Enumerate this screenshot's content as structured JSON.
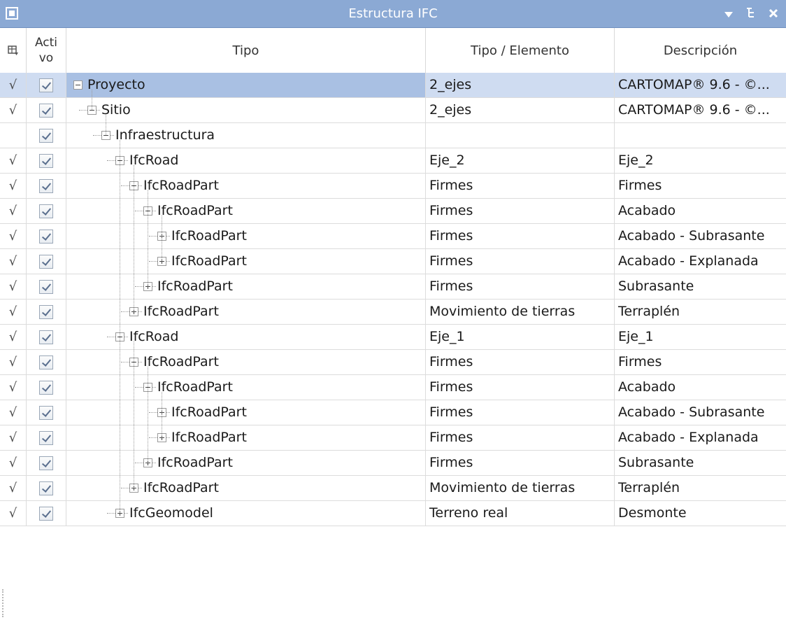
{
  "window": {
    "title": "Estructura IFC"
  },
  "columns": {
    "activo_line1": "Acti",
    "activo_line2": "vo",
    "tipo": "Tipo",
    "tipo_elemento": "Tipo / Elemento",
    "descripcion": "Descripción"
  },
  "rows": [
    {
      "check": "√",
      "active": true,
      "depth": 0,
      "expander": "minus",
      "label": "Proyecto",
      "te": "2_ejes",
      "desc": "CARTOMAP® 9.6 - ©...",
      "selected": true
    },
    {
      "check": "√",
      "active": true,
      "depth": 1,
      "expander": "minus",
      "label": "Sitio",
      "te": "2_ejes",
      "desc": "CARTOMAP® 9.6 - ©..."
    },
    {
      "check": "",
      "active": true,
      "depth": 2,
      "expander": "minus",
      "label": "Infraestructura",
      "te": "",
      "desc": ""
    },
    {
      "check": "√",
      "active": true,
      "depth": 3,
      "expander": "minus",
      "label": "IfcRoad",
      "te": "Eje_2",
      "desc": "Eje_2"
    },
    {
      "check": "√",
      "active": true,
      "depth": 4,
      "expander": "minus",
      "label": "IfcRoadPart",
      "te": "Firmes",
      "desc": "Firmes"
    },
    {
      "check": "√",
      "active": true,
      "depth": 5,
      "expander": "minus",
      "label": "IfcRoadPart",
      "te": "Firmes",
      "desc": "Acabado"
    },
    {
      "check": "√",
      "active": true,
      "depth": 6,
      "expander": "plus",
      "label": "IfcRoadPart",
      "te": "Firmes",
      "desc": "Acabado - Subrasante"
    },
    {
      "check": "√",
      "active": true,
      "depth": 6,
      "expander": "plus",
      "label": "IfcRoadPart",
      "te": "Firmes",
      "desc": "Acabado - Explanada"
    },
    {
      "check": "√",
      "active": true,
      "depth": 5,
      "expander": "plus",
      "label": "IfcRoadPart",
      "te": "Firmes",
      "desc": "Subrasante"
    },
    {
      "check": "√",
      "active": true,
      "depth": 4,
      "expander": "plus",
      "label": "IfcRoadPart",
      "te": "Movimiento de tierras",
      "desc": "Terraplén"
    },
    {
      "check": "√",
      "active": true,
      "depth": 3,
      "expander": "minus",
      "label": "IfcRoad",
      "te": "Eje_1",
      "desc": "Eje_1"
    },
    {
      "check": "√",
      "active": true,
      "depth": 4,
      "expander": "minus",
      "label": "IfcRoadPart",
      "te": "Firmes",
      "desc": "Firmes"
    },
    {
      "check": "√",
      "active": true,
      "depth": 5,
      "expander": "minus",
      "label": "IfcRoadPart",
      "te": "Firmes",
      "desc": "Acabado"
    },
    {
      "check": "√",
      "active": true,
      "depth": 6,
      "expander": "plus",
      "label": "IfcRoadPart",
      "te": "Firmes",
      "desc": "Acabado - Subrasante"
    },
    {
      "check": "√",
      "active": true,
      "depth": 6,
      "expander": "plus",
      "label": "IfcRoadPart",
      "te": "Firmes",
      "desc": "Acabado - Explanada"
    },
    {
      "check": "√",
      "active": true,
      "depth": 5,
      "expander": "plus",
      "label": "IfcRoadPart",
      "te": "Firmes",
      "desc": "Subrasante"
    },
    {
      "check": "√",
      "active": true,
      "depth": 4,
      "expander": "plus",
      "label": "IfcRoadPart",
      "te": "Movimiento de tierras",
      "desc": "Terraplén"
    },
    {
      "check": "√",
      "active": true,
      "depth": 3,
      "expander": "plus",
      "label": "IfcGeomodel",
      "te": "Terreno real",
      "desc": "Desmonte"
    }
  ],
  "icons": {
    "window": "panel-icon",
    "pin": "dropdown-arrow-icon",
    "float": "tree-layout-icon",
    "close": "close-icon",
    "column_chooser": "column-chooser-icon"
  },
  "colors": {
    "titlebar": "#8ba9d4",
    "selection": "#cfdcf1",
    "selection_cell": "#a9c0e3"
  }
}
